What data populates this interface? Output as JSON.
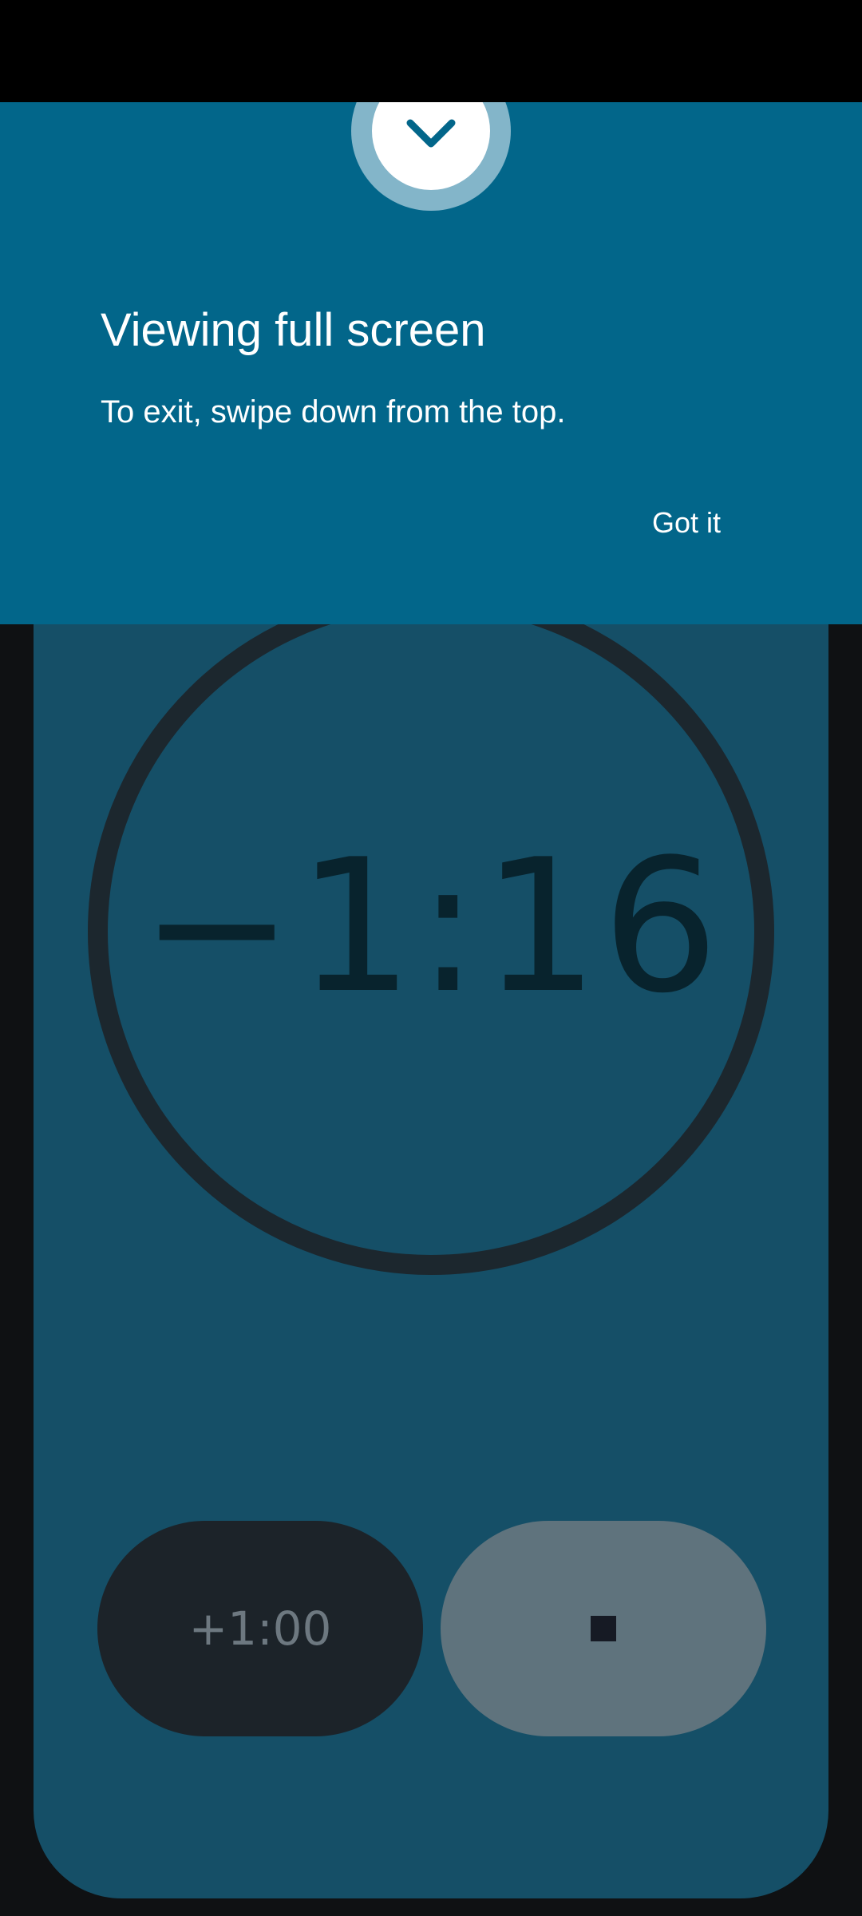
{
  "timer": {
    "value": "−1:16",
    "add_minute_label": "+1:00"
  },
  "hint": {
    "title": "Viewing full screen",
    "message": "To exit, swipe down from the top.",
    "button_label": "Got it"
  },
  "icons": {
    "handle": "chevron-down-icon",
    "stop": "stop-icon"
  },
  "colors": {
    "overlay": "#02668a",
    "timer_card": "#154f67",
    "stop_button": "#5f737d",
    "add_button": "#1c2329"
  }
}
